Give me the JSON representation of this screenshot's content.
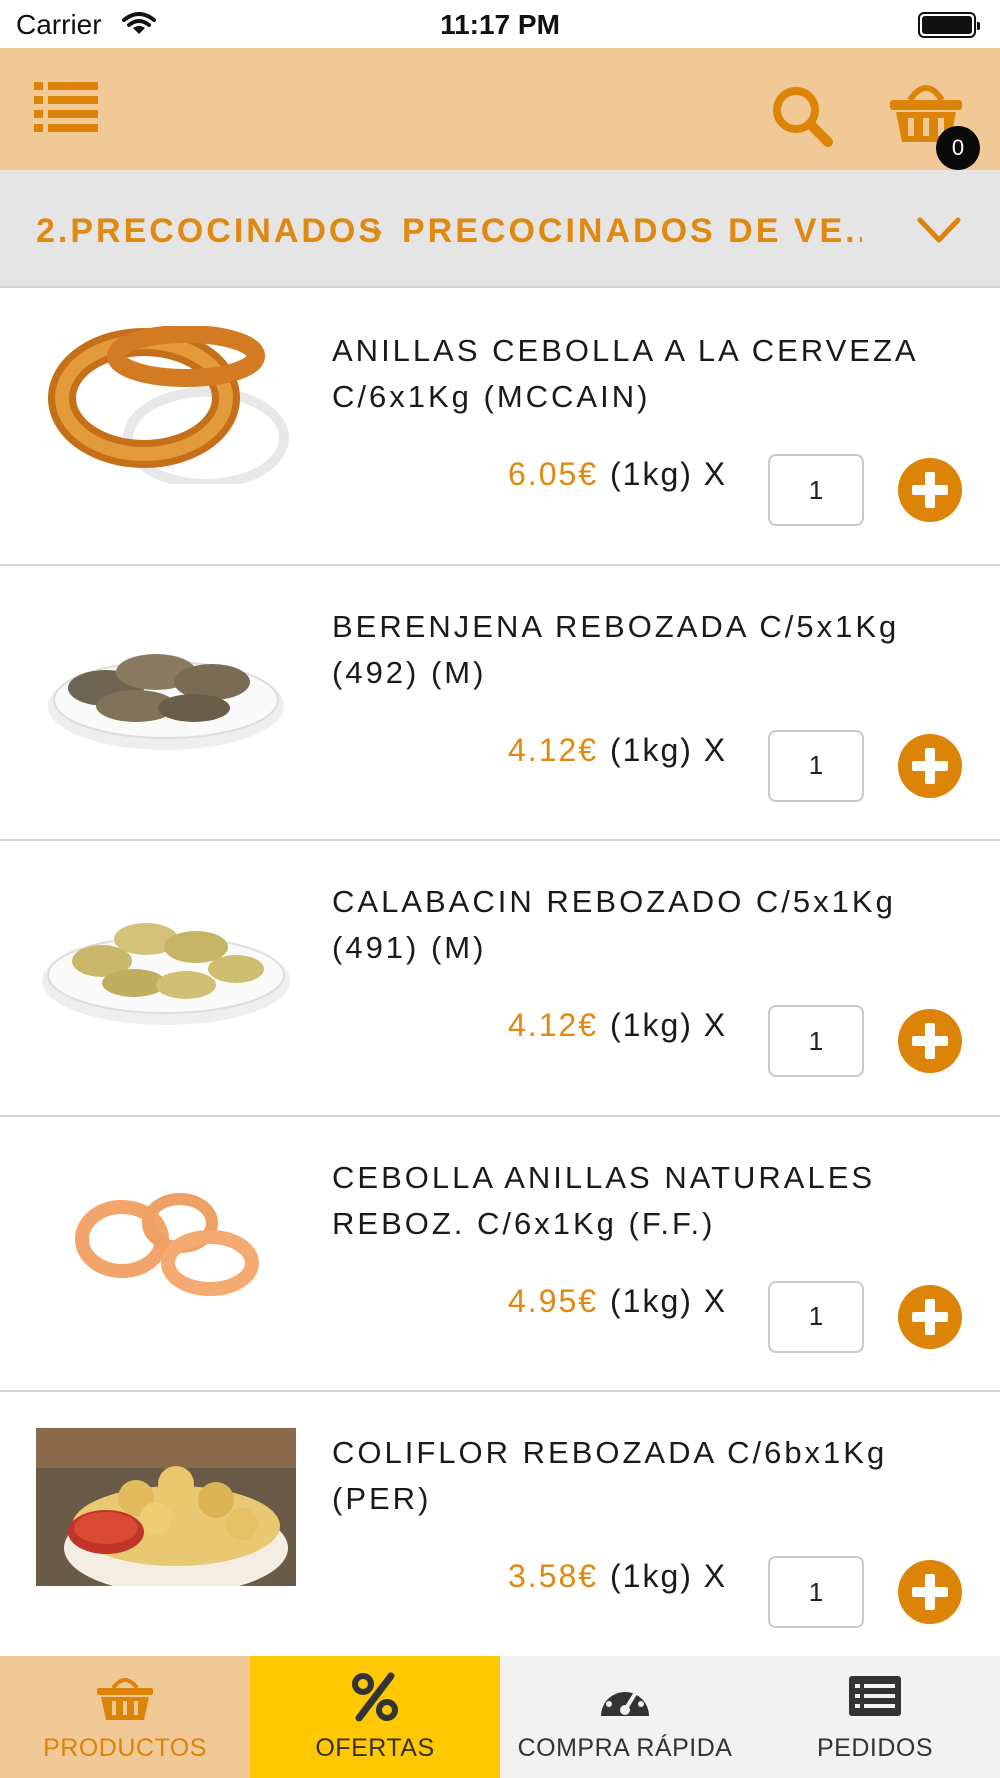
{
  "status_bar": {
    "carrier": "Carrier",
    "time": "11:17 PM"
  },
  "header": {
    "cart_count": "0"
  },
  "breadcrumb": {
    "level1": "2.PRECOCINADOS",
    "separator": "›",
    "level2": "PRECOCINADOS DE VE..."
  },
  "products": [
    {
      "name": "ANILLAS CEBOLLA A LA CERVEZA C/6x1Kg (MCCAIN)",
      "price": "6.05€",
      "unit": "(1kg) X",
      "qty": "1"
    },
    {
      "name": "BERENJENA REBOZADA C/5x1Kg (492) (M)",
      "price": "4.12€",
      "unit": "(1kg) X",
      "qty": "1"
    },
    {
      "name": "CALABACIN REBOZADO C/5x1Kg (491) (M)",
      "price": "4.12€",
      "unit": "(1kg) X",
      "qty": "1"
    },
    {
      "name": "CEBOLLA ANILLAS NATURALES REBOZ. C/6x1Kg (F.F.)",
      "price": "4.95€",
      "unit": "(1kg) X",
      "qty": "1"
    },
    {
      "name": "COLIFLOR REBOZADA C/6bx1Kg (PER)",
      "price": "3.58€",
      "unit": "(1kg) X",
      "qty": "1"
    }
  ],
  "tabs": [
    {
      "label": "PRODUCTOS",
      "icon": "basket-icon"
    },
    {
      "label": "OFERTAS",
      "icon": "percent-icon"
    },
    {
      "label": "COMPRA RÁPIDA",
      "icon": "speedometer-icon"
    },
    {
      "label": "PEDIDOS",
      "icon": "list-icon"
    }
  ],
  "colors": {
    "accent": "#dc8408",
    "header_bg": "#f0c997",
    "offers_tab_bg": "#ffc800",
    "breadcrumb_bg": "#e5e5e5"
  }
}
